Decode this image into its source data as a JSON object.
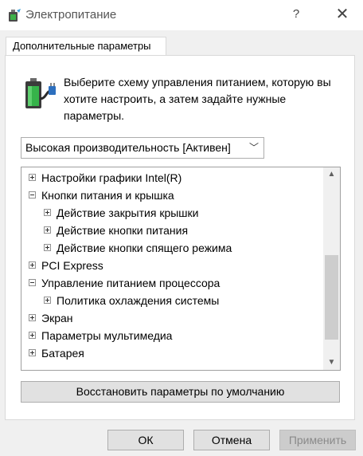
{
  "window": {
    "title": "Электропитание",
    "help_label": "?",
    "close_label": "✕"
  },
  "tab": {
    "label": "Дополнительные параметры"
  },
  "description": "Выберите схему управления питанием, которую вы хотите настроить, а затем задайте нужные параметры.",
  "scheme_select": {
    "value": "Высокая производительность [Активен]"
  },
  "tree": {
    "items": [
      {
        "label": "Настройки графики Intel(R)",
        "level": 0,
        "expanded": false
      },
      {
        "label": "Кнопки питания и крышка",
        "level": 0,
        "expanded": true
      },
      {
        "label": "Действие закрытия крышки",
        "level": 1,
        "expanded": false
      },
      {
        "label": "Действие кнопки питания",
        "level": 1,
        "expanded": false
      },
      {
        "label": "Действие кнопки спящего режима",
        "level": 1,
        "expanded": false
      },
      {
        "label": "PCI Express",
        "level": 0,
        "expanded": false
      },
      {
        "label": "Управление питанием процессора",
        "level": 0,
        "expanded": true
      },
      {
        "label": "Политика охлаждения системы",
        "level": 1,
        "expanded": false
      },
      {
        "label": "Экран",
        "level": 0,
        "expanded": false
      },
      {
        "label": "Параметры мультимедиа",
        "level": 0,
        "expanded": false
      },
      {
        "label": "Батарея",
        "level": 0,
        "expanded": false
      }
    ],
    "scroll": {
      "thumb_start": 0.42,
      "thumb_size": 0.49
    }
  },
  "buttons": {
    "restore": "Восстановить параметры по умолчанию",
    "ok": "ОК",
    "cancel": "Отмена",
    "apply": "Применить"
  },
  "icons": {
    "app": "power-options-icon",
    "battery": "battery-plug-icon",
    "scroll_up": "arrow-up-icon",
    "scroll_down": "arrow-down-icon",
    "dropdown": "chevron-down-icon"
  },
  "colors": {
    "window_bg": "#f0f0f0",
    "panel_bg": "#ffffff",
    "button_bg": "#e1e1e1",
    "disabled_text": "#8a8a8a"
  }
}
